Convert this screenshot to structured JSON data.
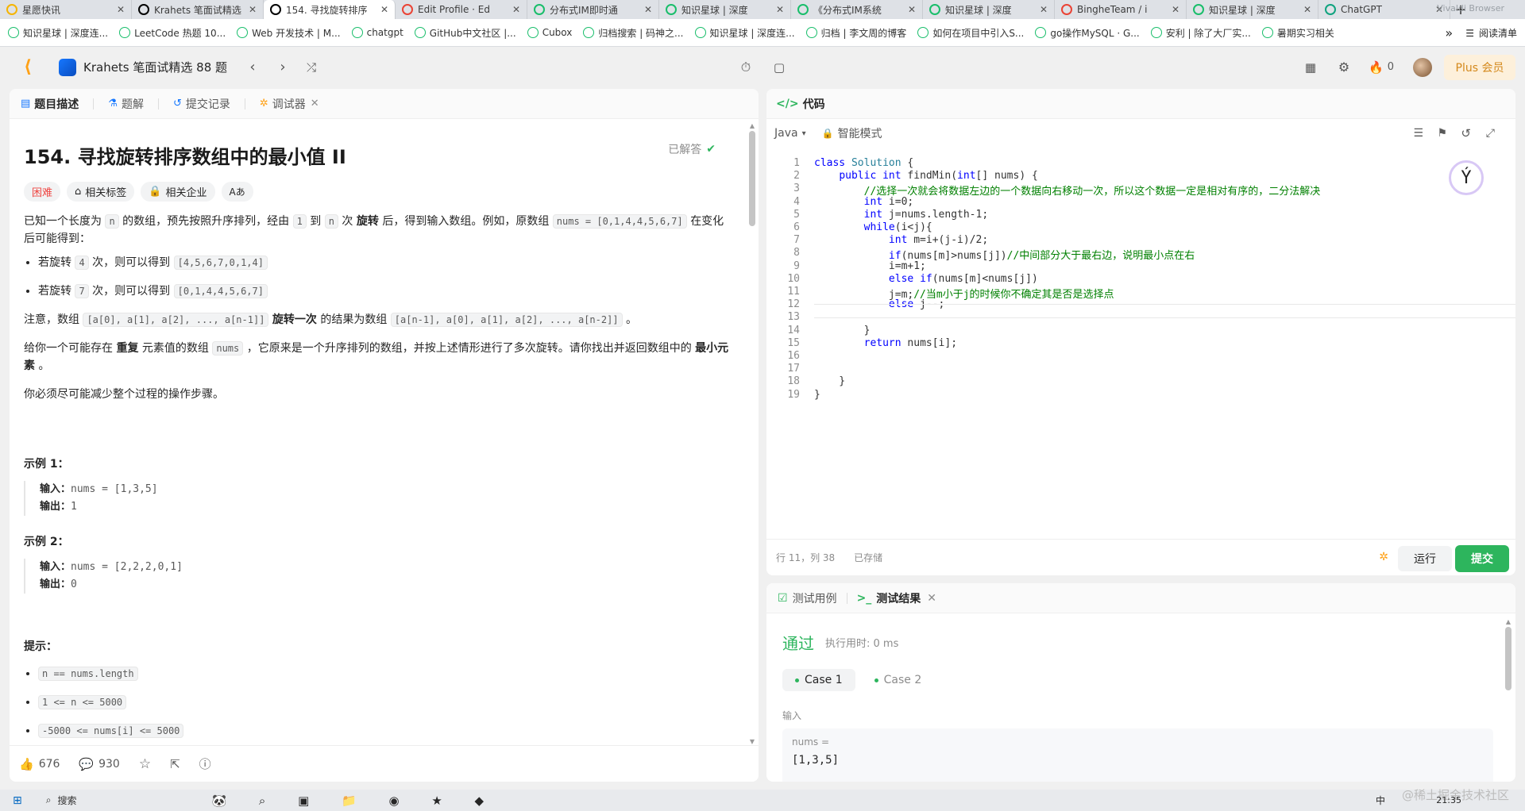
{
  "browser_tabs": [
    {
      "title": "星愿快讯",
      "icon": "star-icon",
      "color": "#f5b400"
    },
    {
      "title": "Krahets 笔面试精选",
      "icon": "leetcode-icon",
      "color": "#000"
    },
    {
      "title": "154. 寻找旋转排序",
      "icon": "leetcode-icon",
      "color": "#000",
      "active": true
    },
    {
      "title": "Edit Profile · Ed",
      "icon": "google-icon",
      "color": "#ea4335"
    },
    {
      "title": "分布式IM即时通",
      "icon": "zsxq-icon",
      "color": "#19be6b"
    },
    {
      "title": "知识星球 | 深度",
      "icon": "zsxq-icon",
      "color": "#19be6b"
    },
    {
      "title": "《分布式IM系统",
      "icon": "zsxq-icon",
      "color": "#19be6b"
    },
    {
      "title": "知识星球 | 深度",
      "icon": "zsxq-icon",
      "color": "#19be6b"
    },
    {
      "title": "BingheTeam / i",
      "icon": "google-icon",
      "color": "#ea4335"
    },
    {
      "title": "知识星球 | 深度",
      "icon": "zsxq-icon",
      "color": "#19be6b"
    },
    {
      "title": "ChatGPT",
      "icon": "chatgpt-icon",
      "color": "#10a37f"
    }
  ],
  "browser_corner_text": "Vivaldi Browser",
  "bookmarks": [
    {
      "label": "知识星球 | 深度连...",
      "icon": "zsxq-icon"
    },
    {
      "label": "LeetCode 热题 10...",
      "icon": "leetcode-icon"
    },
    {
      "label": "Web 开发技术 | M...",
      "icon": "mdn-icon"
    },
    {
      "label": "chatgpt",
      "icon": "chatgpt-icon"
    },
    {
      "label": "GitHub中文社区 |...",
      "icon": "github-icon"
    },
    {
      "label": "Cubox",
      "icon": "cubox-icon"
    },
    {
      "label": "归档搜索 | 码神之...",
      "icon": "spider-icon"
    },
    {
      "label": "知识星球 | 深度连...",
      "icon": "zsxq-icon"
    },
    {
      "label": "归档 | 李文周的博客",
      "icon": "blog-icon"
    },
    {
      "label": "如何在项目中引入S...",
      "icon": "code-icon"
    },
    {
      "label": "go操作MySQL · G...",
      "icon": "book-icon"
    },
    {
      "label": "安利 | 除了大厂实...",
      "icon": "zhihu-icon"
    },
    {
      "label": "暑期实习相关",
      "icon": "folder-icon"
    }
  ],
  "bookmarks_right": {
    "more": "»",
    "reading_list": "阅读清单"
  },
  "app_header": {
    "problem_list": "Krahets 笔面试精选 88 题",
    "streak": "0",
    "plus": "Plus 会员"
  },
  "left_tabs": [
    {
      "label": "题目描述",
      "icon": "doc-icon",
      "active": true
    },
    {
      "label": "题解",
      "icon": "flask-icon"
    },
    {
      "label": "提交记录",
      "icon": "history-icon"
    },
    {
      "label": "调试器",
      "icon": "debug-icon",
      "closable": true
    }
  ],
  "problem": {
    "title": "154. 寻找旋转排序数组中的最小值 II",
    "status": "已解答",
    "difficulty": "困难",
    "tag_topics": "相关标签",
    "tag_companies": "相关企业",
    "tag_font": "Aあ",
    "desc1_a": "已知一个长度为",
    "desc1_n": "n",
    "desc1_b": "的数组，预先按照升序排列，经由",
    "desc1_one": "1",
    "desc1_c": "到",
    "desc1_n2": "n",
    "desc1_d": "次",
    "desc1_rot": "旋转",
    "desc1_e": "后，得到输入数组。例如，原数组",
    "desc1_nums": "nums = [0,1,4,4,5,6,7]",
    "desc1_f": "在变化后可能得到：",
    "bullet1_a": "若旋转",
    "bullet1_k": "4",
    "bullet1_b": "次，则可以得到",
    "bullet1_r": "[4,5,6,7,0,1,4]",
    "bullet2_a": "若旋转",
    "bullet2_k": "7",
    "bullet2_b": "次，则可以得到",
    "bullet2_r": "[0,1,4,4,5,6,7]",
    "note_a": "注意，数组",
    "note_arr": "[a[0], a[1], a[2], ..., a[n-1]]",
    "note_b": "旋转一次",
    "note_c": "的结果为数组",
    "note_arr2": "[a[n-1], a[0], a[1], a[2], ..., a[n-2]]",
    "note_d": "。",
    "give_a": "给你一个可能存在",
    "give_b": "重复",
    "give_c": "元素值的数组",
    "give_nums": "nums",
    "give_d": "，它原来是一个升序排列的数组，并按上述情形进行了多次旋转。请你找出并返回数组中的",
    "give_e": "最小元素",
    "give_f": "。",
    "must": "你必须尽可能减少整个过程的操作步骤。",
    "ex1_h": "示例 1：",
    "ex1_in_label": "输入：",
    "ex1_in": "nums = [1,3,5]",
    "ex1_out_label": "输出：",
    "ex1_out": "1",
    "ex2_h": "示例 2：",
    "ex2_in_label": "输入：",
    "ex2_in": "nums = [2,2,2,0,1]",
    "ex2_out_label": "输出：",
    "ex2_out": "0",
    "hint_h": "提示：",
    "hints": [
      "n == nums.length",
      "1 <= n <= 5000",
      "-5000 <= nums[i] <= 5000"
    ]
  },
  "left_footer": {
    "likes": "676",
    "comments": "930"
  },
  "code_panel": {
    "title": "代码",
    "language": "Java",
    "mode": "智能模式",
    "status_pos": "行 11，列 38",
    "status_saved": "已存储",
    "run": "运行",
    "submit": "提交"
  },
  "code_lines": [
    "class Solution {",
    "    public int findMin(int[] nums) {",
    "        //选择一次就会将数据左边的一个数据向右移动一次，所以这个数据一定是相对有序的，二分法解决",
    "        int i=0;",
    "        int j=nums.length-1;",
    "        while(i<j){",
    "            int m=i+(j-i)/2;",
    "            if(nums[m]>nums[j])//中间部分大于最右边，说明最小点在右",
    "            i=m+1;",
    "            else if(nums[m]<nums[j])",
    "            j=m;//当m小于j的时候你不确定其是否是选择点",
    "            else j--;",
    "",
    "        }",
    "        return nums[i];",
    "",
    "",
    "    }",
    "}"
  ],
  "test_panel": {
    "tab_cases": "测试用例",
    "tab_result": "测试结果",
    "result": "通过",
    "runtime": "执行用时: 0 ms",
    "case1": "Case 1",
    "case2": "Case 2",
    "input_label": "输入",
    "var_name": "nums =",
    "var_value": "[1,3,5]"
  },
  "taskbar": {
    "search": "搜索",
    "watermark": "@稀土掘金技术社区",
    "ime": "中",
    "time": "21:35"
  }
}
